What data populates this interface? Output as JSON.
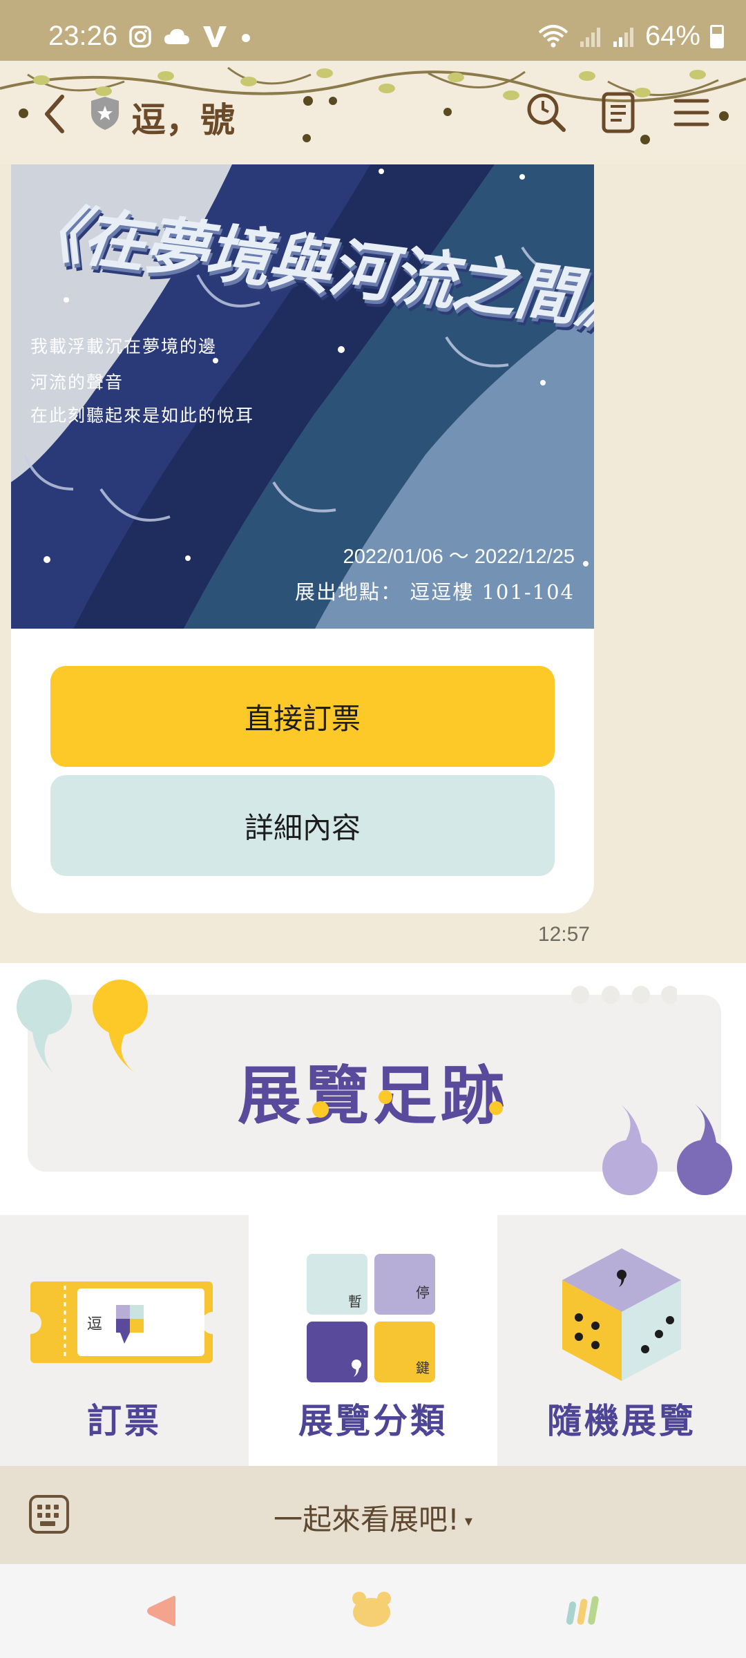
{
  "status_bar": {
    "time": "23:26",
    "battery": "64%",
    "icons": [
      "instagram-icon",
      "cloud-icon",
      "v-app-icon",
      "dot-icon",
      "wifi-icon",
      "signal-icon",
      "signal-icon",
      "battery-icon"
    ]
  },
  "header": {
    "title": "逗，號",
    "icons": [
      "back-arrow-icon",
      "shield-star-icon",
      "search-icon",
      "notes-icon",
      "menu-icon"
    ]
  },
  "message": {
    "poster": {
      "title": "《在夢境與河流之間》",
      "lines": [
        "我載浮載沉在夢境的邊",
        "河流的聲音",
        "在此刻聽起來是如此的悅耳"
      ],
      "date_range": "2022/01/06 ～ 2022/12/25",
      "venue": "展出地點：  逗逗樓    101-104"
    },
    "buttons": {
      "book": "直接訂票",
      "details": "詳細內容"
    },
    "time": "12:57"
  },
  "rich_menu": {
    "banner_title": "展覽足跡",
    "items": [
      {
        "label": "訂票",
        "icon": "ticket-icon",
        "ticket_text": "逗"
      },
      {
        "label": "展覽分類",
        "icon": "category-tiles-icon",
        "tiles": [
          "暫",
          "停",
          "",
          "鍵"
        ]
      },
      {
        "label": "隨機展覽",
        "icon": "dice-icon"
      }
    ]
  },
  "chat_bar": {
    "menu_label": "一起來看展吧!",
    "caret": "▾"
  },
  "colors": {
    "status_bar": "#c1ae80",
    "accent_yellow": "#fcc928",
    "accent_mint": "#d4e9e7",
    "purple": "#5a4a9c",
    "poster_navy": "#2c3a73"
  }
}
